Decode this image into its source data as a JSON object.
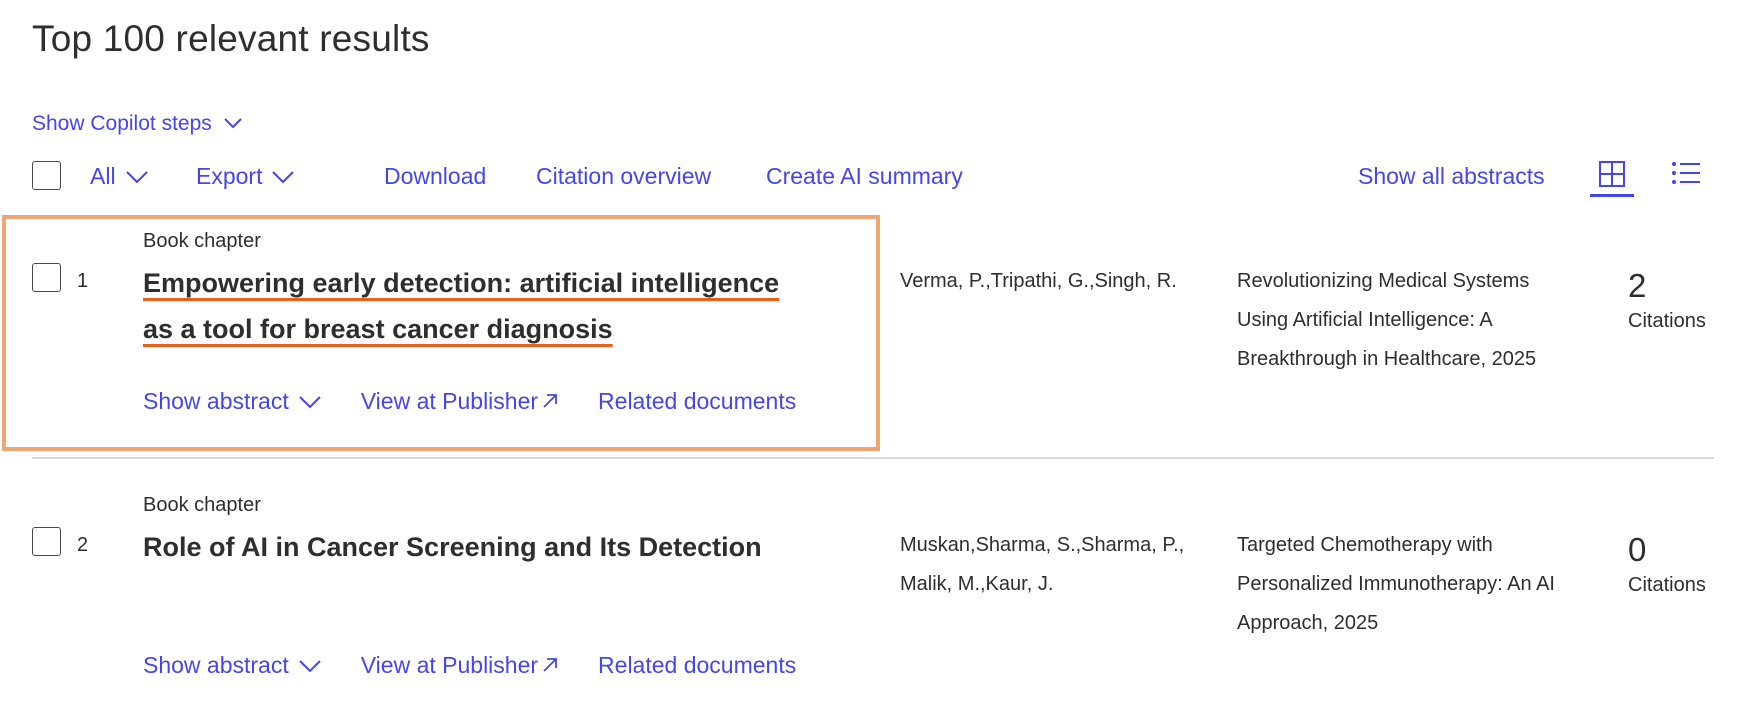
{
  "header": {
    "title": "Top 100 relevant results",
    "copilot_label": "Show Copilot steps"
  },
  "toolbar": {
    "all_label": "All",
    "export_label": "Export",
    "download_label": "Download",
    "citation_overview_label": "Citation overview",
    "ai_summary_label": "Create AI summary",
    "show_abstracts_label": "Show all abstracts",
    "view_grid_icon": "grid-view-icon",
    "view_list_icon": "list-view-icon",
    "active_view": "grid"
  },
  "results": [
    {
      "doc_type": "Book chapter",
      "number": "1",
      "title_line1": "Empowering early detection: artificial intelligence",
      "title_line2": "as a tool for breast cancer diagnosis",
      "authors": "Verma, P.,Tripathi, G.,Singh, R.",
      "source_line1": "Revolutionizing Medical Systems",
      "source_line2": "Using Artificial Intelligence: A",
      "source_line3": "Breakthrough in Healthcare, 2025",
      "citations": "2",
      "citations_label": "Citations",
      "show_abstract": "Show abstract",
      "view_publisher": "View at Publisher",
      "related": "Related documents"
    },
    {
      "doc_type": "Book chapter",
      "number": "2",
      "title_line1": "Role of AI in Cancer Screening and Its Detection",
      "authors_line1": "Muskan,Sharma, S.,Sharma, P.,",
      "authors_line2": "Malik, M.,Kaur, J.",
      "source_line1": "Targeted Chemotherapy with",
      "source_line2": "Personalized Immunotherapy: An AI",
      "source_line3": "Approach, 2025",
      "citations": "0",
      "citations_label": "Citations",
      "show_abstract": "Show abstract",
      "view_publisher": "View at Publisher",
      "related": "Related documents"
    }
  ],
  "colors": {
    "link": "#4646e8",
    "text": "#2e2e2e",
    "highlight_border": "#f0a674",
    "title_underline": "#e8601c"
  }
}
